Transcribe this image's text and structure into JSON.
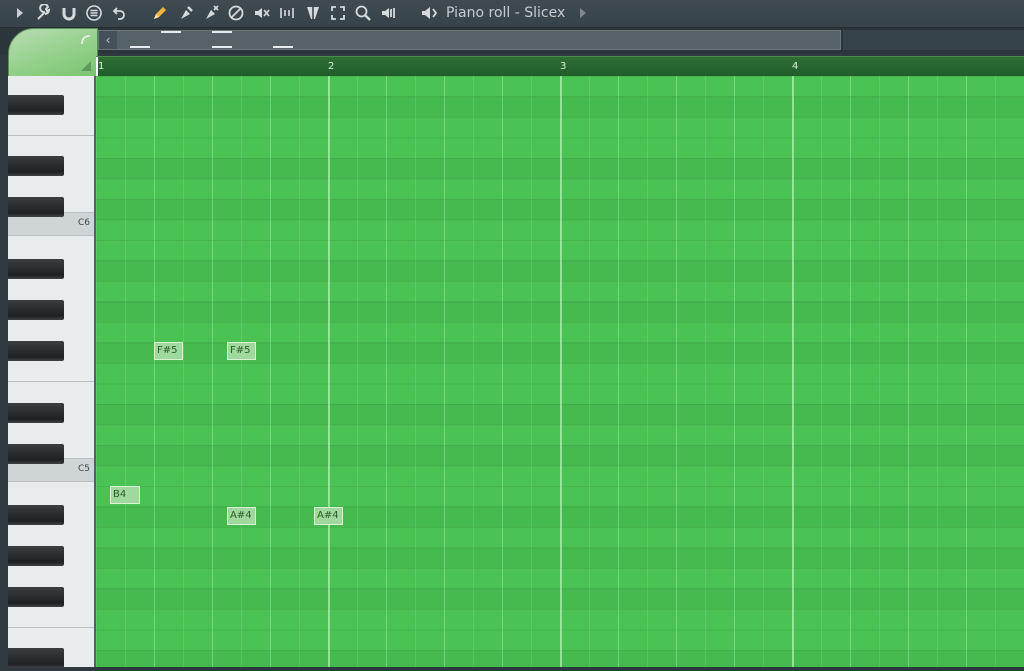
{
  "toolbar": {
    "icons": [
      "play-arrow-icon",
      "wrench-icon",
      "magnet-icon",
      "menu-icon",
      "undo-icon",
      "pencil-icon",
      "paint-brush-icon",
      "delete-brush-icon",
      "mute-icon",
      "speaker-mute-icon",
      "slice-icon",
      "slip-icon",
      "select-icon",
      "zoom-icon",
      "playback-icon"
    ],
    "title": "Piano roll - Slicex"
  },
  "ruler": {
    "bars": [
      "1",
      "2",
      "3",
      "4"
    ]
  },
  "keyboard": {
    "labels": {
      "c6": "C6",
      "c5": "C5"
    }
  },
  "notes": [
    {
      "label": "F#5",
      "pitch": "F#5",
      "start_beat": 2.0,
      "length_steps": 1
    },
    {
      "label": "F#5",
      "pitch": "F#5",
      "start_beat": 3.0,
      "length_steps": 1
    },
    {
      "label": "B4",
      "pitch": "B4",
      "start_beat": 1.5,
      "length_steps": 1
    },
    {
      "label": "A#4",
      "pitch": "A#4",
      "start_beat": 3.0,
      "length_steps": 1
    },
    {
      "label": "A#4",
      "pitch": "A#4",
      "start_beat": 4.5,
      "length_steps": 1
    }
  ],
  "colors": {
    "grid": "#4bc354",
    "note": "#9fd99e",
    "toolbar": "#3b474d"
  }
}
